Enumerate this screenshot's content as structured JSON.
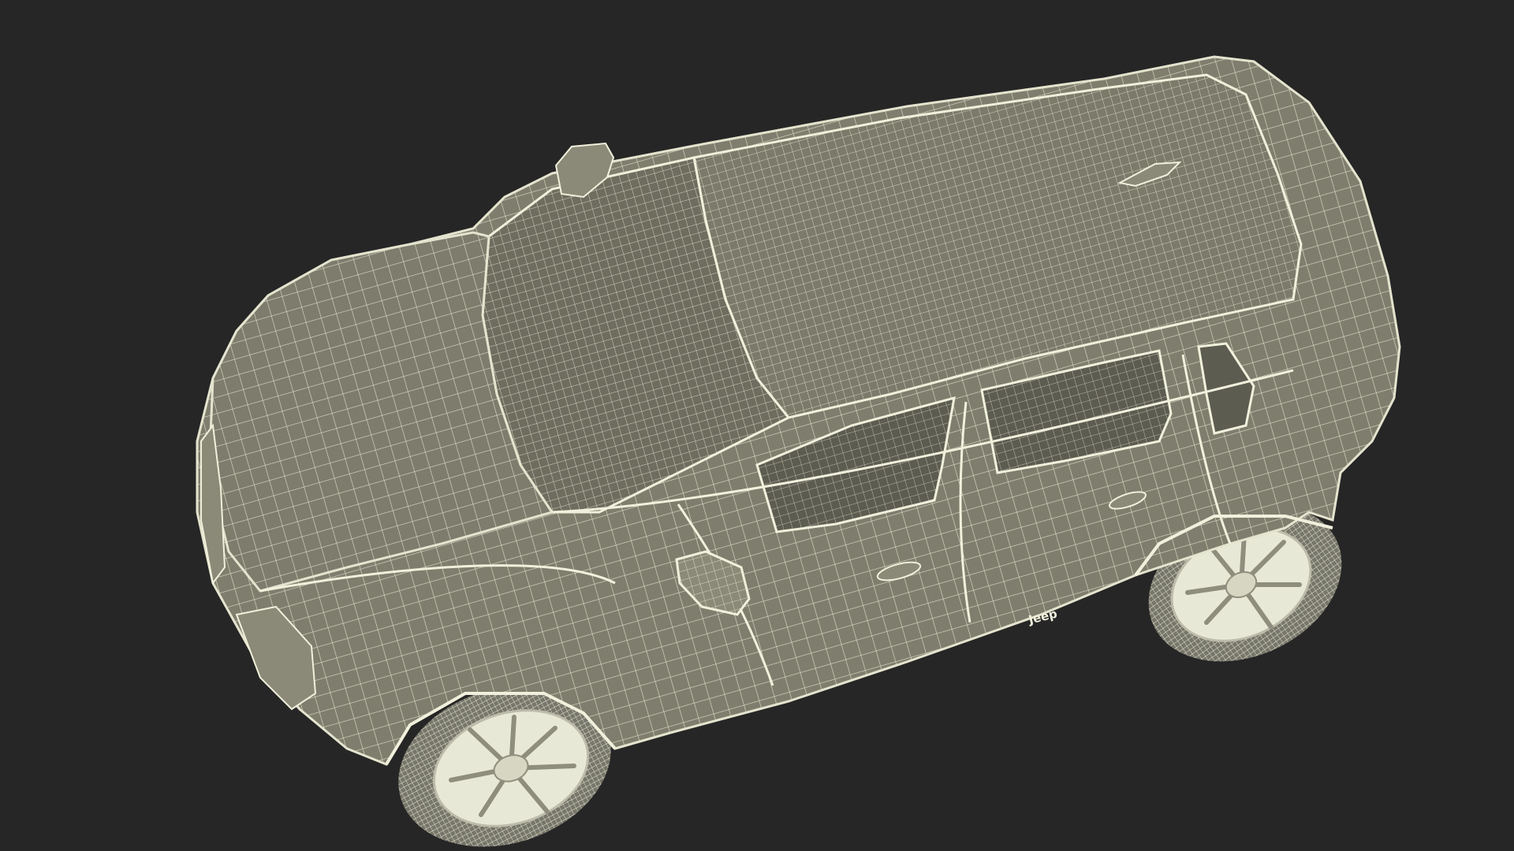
{
  "scene": {
    "subject": "suv-wireframe-model",
    "colors": {
      "background": "#262626",
      "body_fill": "#7f7e6e",
      "body_fill_dark": "#6d6c5e",
      "wire": "#e4e4cf",
      "wire_faint": "#cfcfba",
      "glass": "#5d5c51",
      "tire": "#77766a",
      "rim": "#e8e8d6"
    }
  },
  "badge": {
    "text": "Jeep"
  }
}
